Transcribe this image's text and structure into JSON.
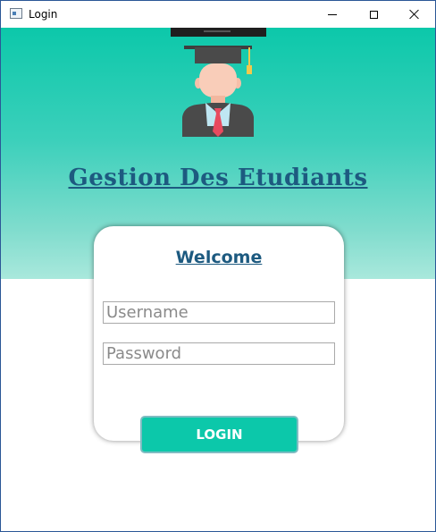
{
  "window": {
    "title": "Login",
    "icon": "window-app-icon",
    "controls": [
      "minimize-icon",
      "maximize-icon",
      "close-icon"
    ]
  },
  "header": {
    "title": "Gestion Des Etudiants",
    "image": "graduate-icon",
    "gradient_top": "#0cc8aa",
    "gradient_bottom": "#a9e8dc"
  },
  "login_card": {
    "welcome": "Welcome",
    "username": {
      "value": "",
      "placeholder": "Username"
    },
    "password": {
      "value": "",
      "placeholder": "Password"
    },
    "login_label": "LOGIN"
  },
  "colors": {
    "accent": "#0cc8aa",
    "title": "#1d5a80"
  }
}
